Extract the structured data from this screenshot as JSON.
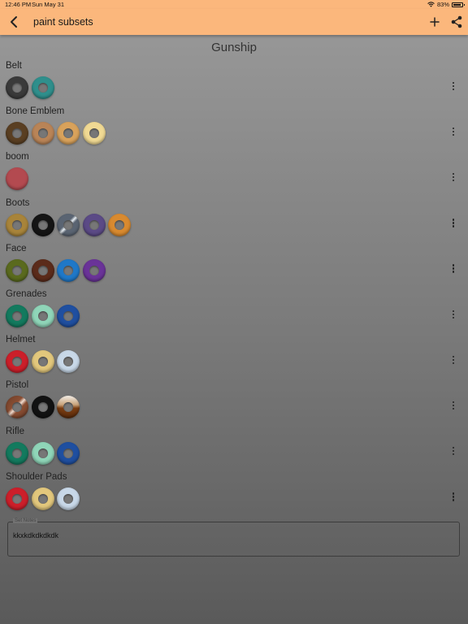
{
  "status": {
    "time": "12:46 PM",
    "date": "Sun May 31",
    "battery": "83%"
  },
  "appbar": {
    "title": "paint subsets"
  },
  "set_title": "Gunship",
  "groups": [
    {
      "name": "Belt",
      "swatches": [
        "#3a3a3a",
        "#2f8f8c"
      ]
    },
    {
      "name": "Bone Emblem",
      "swatches": [
        "#5a3f22",
        "#b98457",
        "#d9a25b",
        "#f0d993"
      ]
    },
    {
      "name": "boom",
      "swatches": [
        "#b34a50"
      ]
    },
    {
      "name": "Boots",
      "swatches": [
        "#a8843a",
        "#151515",
        "metallic-silver",
        "#5b4a86",
        "#d98a2f"
      ]
    },
    {
      "name": "Face",
      "swatches": [
        "#5a6a1e",
        "#5b2b1a",
        "#1f78c8",
        "#6a3398"
      ]
    },
    {
      "name": "Grenades",
      "swatches": [
        "#137a5e",
        "#8fd5b8",
        "#1f4fa0"
      ]
    },
    {
      "name": "Helmet",
      "swatches": [
        "#cc1f2a",
        "#e2c77c",
        "#c8d8e8"
      ]
    },
    {
      "name": "Pistol",
      "swatches": [
        "metallic-copper",
        "#121212",
        "metallic-bronze"
      ]
    },
    {
      "name": "Rifle",
      "swatches": [
        "#137a5e",
        "#8fd5b8",
        "#1f4fa0"
      ]
    },
    {
      "name": "Shoulder Pads",
      "swatches": [
        "#cc1f2a",
        "#e2c77c",
        "#c8d8e8"
      ]
    }
  ],
  "notes": {
    "label": "Set Notes",
    "value": "kkxkdkdkdkdk"
  }
}
